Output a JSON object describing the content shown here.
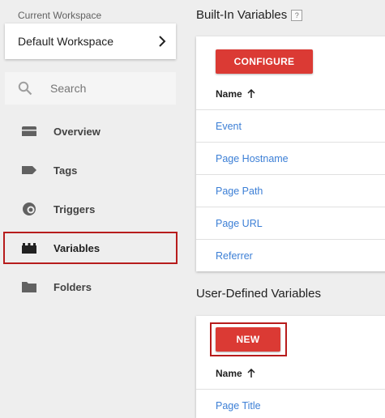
{
  "sidebar": {
    "workspace_label": "Current Workspace",
    "workspace_name": "Default Workspace",
    "search_placeholder": "Search",
    "nav": [
      {
        "label": "Overview",
        "icon": "overview-icon"
      },
      {
        "label": "Tags",
        "icon": "tag-icon"
      },
      {
        "label": "Triggers",
        "icon": "trigger-icon"
      },
      {
        "label": "Variables",
        "icon": "variables-icon",
        "active": true
      },
      {
        "label": "Folders",
        "icon": "folder-icon"
      }
    ]
  },
  "builtin": {
    "title": "Built-In Variables",
    "help": "?",
    "button": "CONFIGURE",
    "column": "Name",
    "rows": [
      "Event",
      "Page Hostname",
      "Page Path",
      "Page URL",
      "Referrer"
    ]
  },
  "user_defined": {
    "title": "User-Defined Variables",
    "button": "NEW",
    "column": "Name",
    "rows": [
      "Page Title"
    ]
  },
  "colors": {
    "accent": "#db3a34",
    "highlight_outline": "#b71c1c",
    "link": "#3c7fd6"
  }
}
